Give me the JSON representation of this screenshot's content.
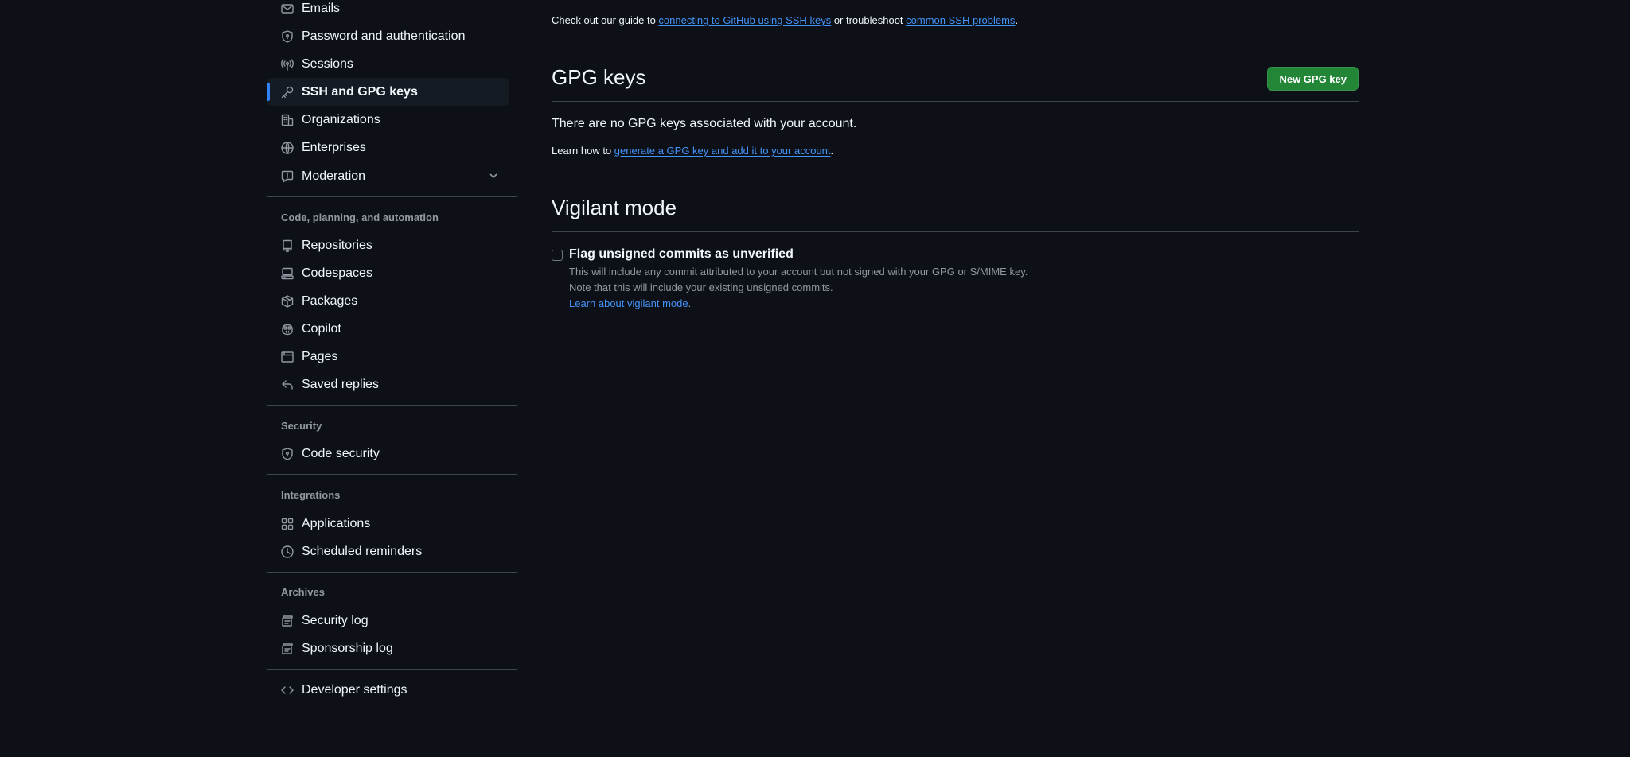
{
  "sidebar": {
    "top_items": [
      {
        "label": "Emails",
        "icon": "mail-icon"
      },
      {
        "label": "Password and authentication",
        "icon": "shield-lock-icon"
      },
      {
        "label": "Sessions",
        "icon": "broadcast-icon"
      },
      {
        "label": "SSH and GPG keys",
        "icon": "key-icon",
        "active": true
      },
      {
        "label": "Organizations",
        "icon": "organization-icon"
      },
      {
        "label": "Enterprises",
        "icon": "globe-icon"
      },
      {
        "label": "Moderation",
        "icon": "report-icon",
        "expandable": true
      }
    ],
    "code_group": {
      "heading": "Code, planning, and automation",
      "items": [
        {
          "label": "Repositories",
          "icon": "repo-icon"
        },
        {
          "label": "Codespaces",
          "icon": "codespaces-icon"
        },
        {
          "label": "Packages",
          "icon": "package-icon"
        },
        {
          "label": "Copilot",
          "icon": "copilot-icon"
        },
        {
          "label": "Pages",
          "icon": "browser-icon"
        },
        {
          "label": "Saved replies",
          "icon": "reply-icon"
        }
      ]
    },
    "security_group": {
      "heading": "Security",
      "items": [
        {
          "label": "Code security",
          "icon": "shield-lock-icon"
        }
      ]
    },
    "integrations_group": {
      "heading": "Integrations",
      "items": [
        {
          "label": "Applications",
          "icon": "apps-icon"
        },
        {
          "label": "Scheduled reminders",
          "icon": "clock-icon"
        }
      ]
    },
    "archives_group": {
      "heading": "Archives",
      "items": [
        {
          "label": "Security log",
          "icon": "log-icon"
        },
        {
          "label": "Sponsorship log",
          "icon": "log-icon"
        }
      ]
    },
    "developer": {
      "label": "Developer settings",
      "icon": "code-icon"
    }
  },
  "main": {
    "ssh_guide": {
      "prefix": "Check out our guide to ",
      "link1": "connecting to GitHub using SSH keys",
      "middle": " or troubleshoot ",
      "link2": "common SSH problems",
      "suffix": "."
    },
    "gpg": {
      "title": "GPG keys",
      "new_button": "New GPG key",
      "empty_text": "There are no GPG keys associated with your account.",
      "learn_prefix": "Learn how to ",
      "learn_link": "generate a GPG key and add it to your account",
      "learn_suffix": "."
    },
    "vigilant": {
      "title": "Vigilant mode",
      "checkbox_label": "Flag unsigned commits as unverified",
      "checked": false,
      "note_line1": "This will include any commit attributed to your account but not signed with your GPG or S/MIME key.",
      "note_line2": "Note that this will include your existing unsigned commits.",
      "learn_link": "Learn about vigilant mode",
      "learn_suffix": "."
    }
  },
  "colors": {
    "background": "#0d1117",
    "accent_blue": "#2f81f7",
    "link": "#4493f8",
    "button_green": "#238636",
    "muted": "#9198a1"
  }
}
